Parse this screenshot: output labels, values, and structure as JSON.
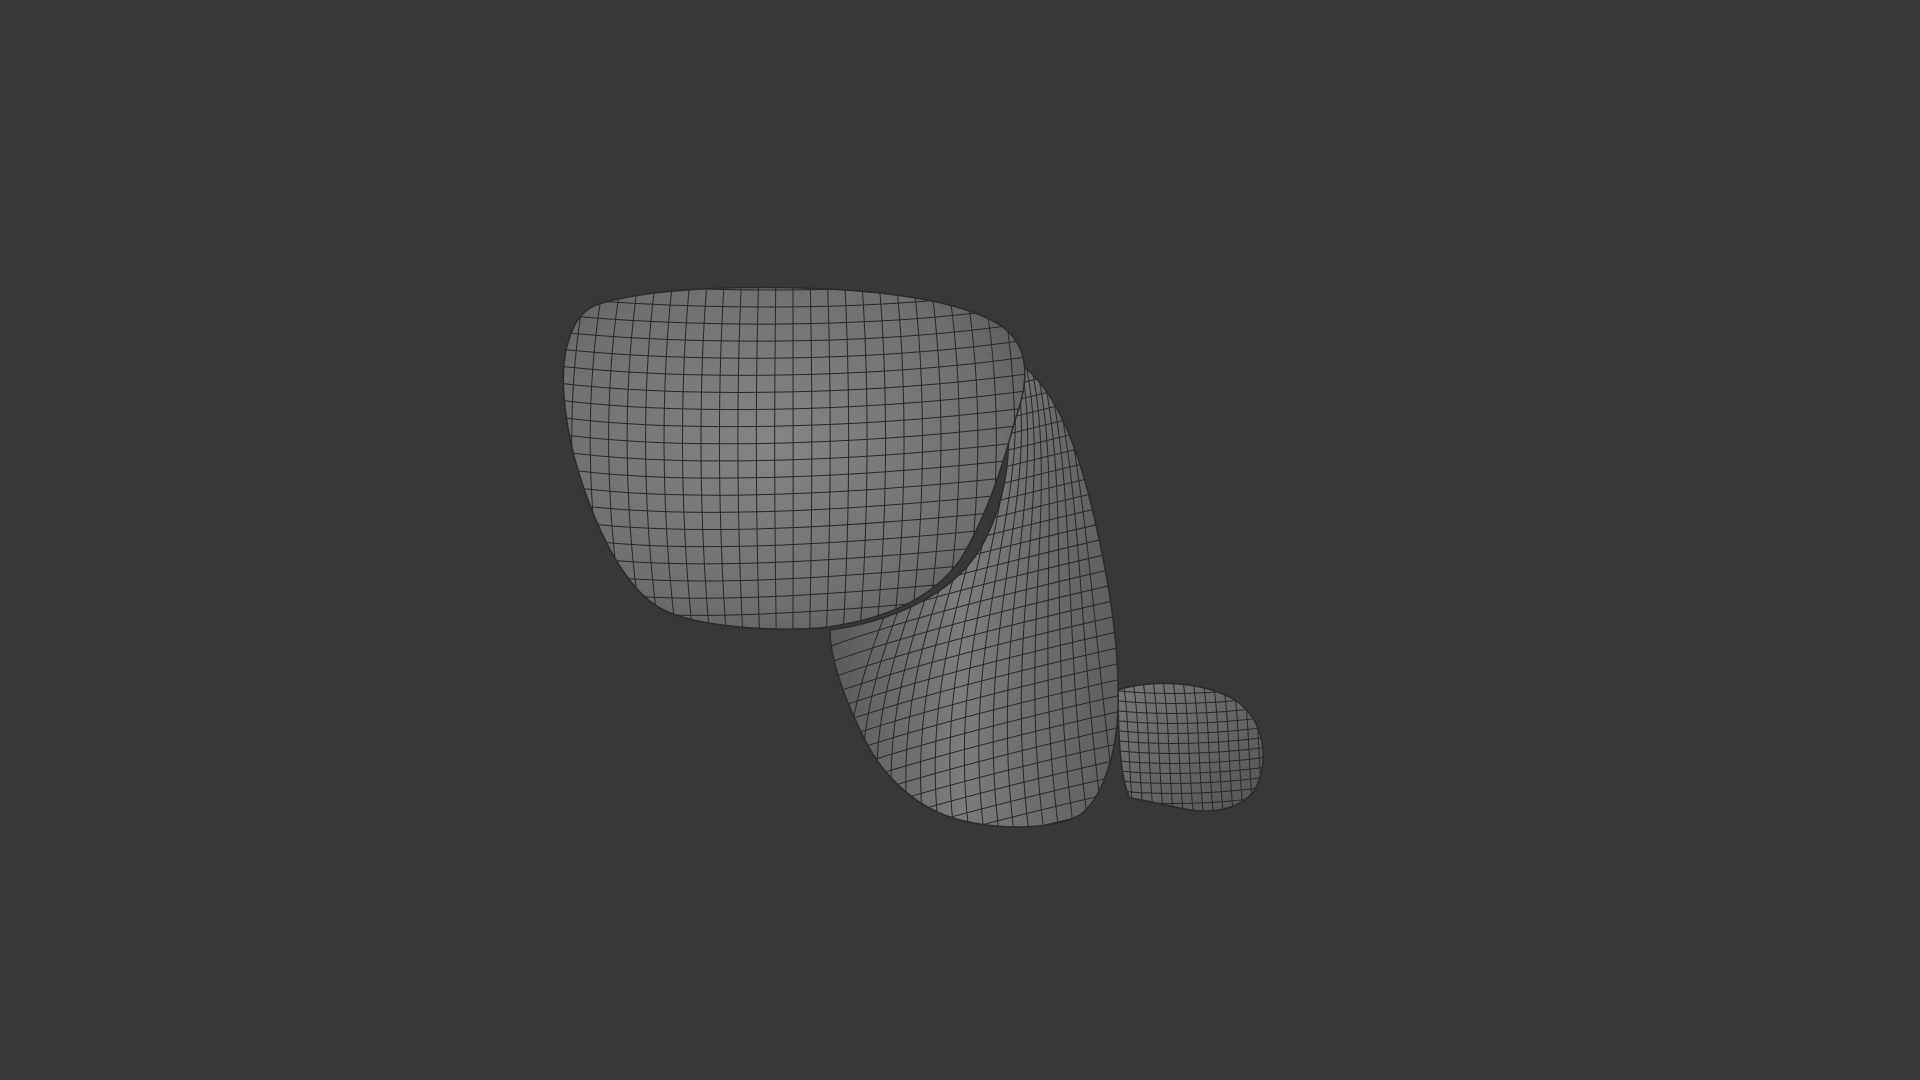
{
  "viewport": {
    "background_color": "#383838",
    "mesh_fill_color": "#737373",
    "mesh_wire_color": "#262626",
    "mesh_highlight_color": "#8a8a8a",
    "mesh_shadow_color": "#4a4a4a",
    "shading_mode": "solid-wireframe"
  }
}
